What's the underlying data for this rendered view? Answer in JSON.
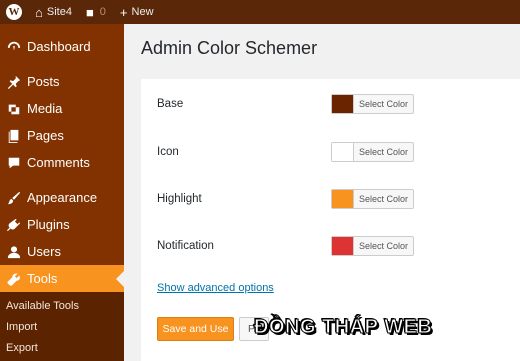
{
  "adminbar": {
    "site_name": "Site4",
    "comments_count": "0",
    "new_label": "New",
    "wp_logo": "W"
  },
  "sidebar": {
    "items": [
      {
        "label": "Dashboard",
        "icon": "dashboard-icon"
      },
      {
        "label": "Posts",
        "icon": "pin-icon"
      },
      {
        "label": "Media",
        "icon": "media-icon"
      },
      {
        "label": "Pages",
        "icon": "pages-icon"
      },
      {
        "label": "Comments",
        "icon": "comment-icon"
      },
      {
        "label": "Appearance",
        "icon": "brush-icon"
      },
      {
        "label": "Plugins",
        "icon": "plugin-icon"
      },
      {
        "label": "Users",
        "icon": "user-icon"
      },
      {
        "label": "Tools",
        "icon": "wrench-icon",
        "current": true
      }
    ],
    "submenu": [
      "Available Tools",
      "Import",
      "Export"
    ]
  },
  "page": {
    "title": "Admin Color Schemer"
  },
  "colors": {
    "rows": [
      {
        "label": "Base",
        "color": "#6b2400",
        "button": "Select Color"
      },
      {
        "label": "Icon",
        "color": "#ffffff",
        "button": "Select Color"
      },
      {
        "label": "Highlight",
        "color": "#f8931f",
        "button": "Select Color"
      },
      {
        "label": "Notification",
        "color": "#dd3333",
        "button": "Select Color"
      }
    ]
  },
  "actions": {
    "advanced_link": "Show advanced options",
    "save_button": "Save and Use",
    "secondary_button": "P"
  },
  "theme": {
    "admin_bar": "#5a2708",
    "menu_bg": "#823200",
    "menu_current": "#f8931f",
    "submenu_bg": "#5b2300"
  },
  "watermark": "ĐỒNG THÁP WEB"
}
